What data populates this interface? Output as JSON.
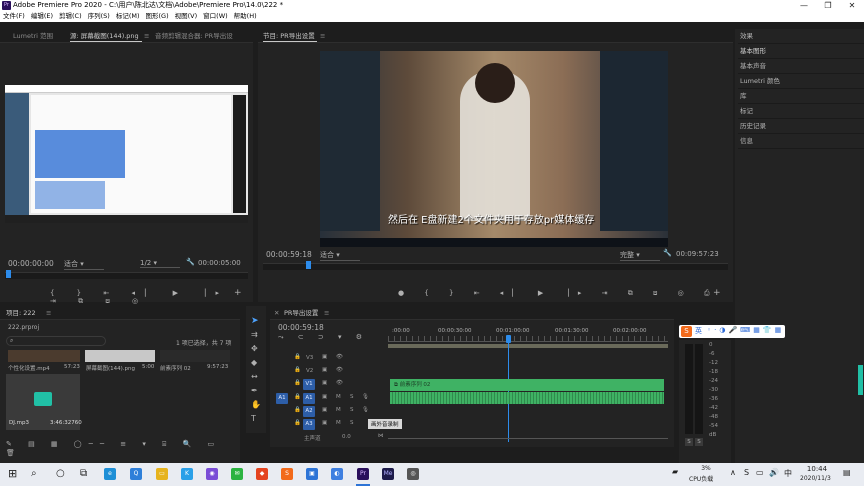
{
  "window": {
    "title": "Adobe Premiere Pro 2020 - C:\\用户\\陈北达\\文档\\Adobe\\Premiere Pro\\14.0\\222 *",
    "app_icon_text": "Pr"
  },
  "menu": [
    "文件(F)",
    "编辑(E)",
    "剪辑(C)",
    "序列(S)",
    "标记(M)",
    "图形(G)",
    "视图(V)",
    "窗口(W)",
    "帮助(H)"
  ],
  "source_panel": {
    "tabs": [
      "Lumetri 范围",
      "源: 屏幕截图(144).png",
      "音频剪辑混合器: PR导出设",
      "≡"
    ],
    "timecode_left": "00:00:00:00",
    "fit": "适合",
    "zoom": "1/2",
    "timecode_right": "00:00:05:00"
  },
  "program_panel": {
    "tab": "节目: PR导出设置",
    "timecode_left": "00:00:59:18",
    "fit": "适合",
    "quality": "完整",
    "timecode_right": "00:09:57:23",
    "subtitle": "然后在 E盘新建2个文件夹用于存放pr媒体缓存"
  },
  "right_panel": {
    "items": [
      "效果",
      "基本图形",
      "基本声音",
      "Lumetri 颜色",
      "库",
      "标记",
      "历史记录",
      "信息"
    ]
  },
  "project_panel": {
    "tab": "项目: 222",
    "file": "222.prproj",
    "selection": "1 项已选择，共 7 项",
    "items": [
      {
        "name": "个性化设置.mp4",
        "duration": "57:23"
      },
      {
        "name": "屏幕截图(144).png",
        "duration": "5:00"
      },
      {
        "name": "前素序列 02",
        "duration": "9:57:23"
      }
    ],
    "audio_item": {
      "name": "DJ.mp3",
      "duration": "3:46:32760"
    }
  },
  "timeline": {
    "tab": "PR导出设置",
    "timecode": "00:00:59:18",
    "ruler": [
      ":00:00",
      "00:00:30:00",
      "00:01:00:00",
      "00:01:30:00",
      "00:02:00:00"
    ],
    "tracks": [
      "V3",
      "V2",
      "V1",
      "A1",
      "A2",
      "A3"
    ],
    "master": "主声道",
    "master_value": "0.0",
    "clip_label": "前素序列 02",
    "tooltip": "画外音录制",
    "a1_label": "A1"
  },
  "meter": {
    "labels": [
      "0",
      "-6",
      "-12",
      "-18",
      "-24",
      "-30",
      "-36",
      "-42",
      "-48",
      "-54",
      "dB"
    ],
    "bottom": [
      "S",
      "S"
    ]
  },
  "sogou": {
    "label": "英"
  },
  "taskbar": {
    "cpu_percent": "3%",
    "cpu_label": "CPU负载",
    "lang": "中",
    "time": "10:44",
    "date": "2020/11/3",
    "apps": [
      "Pr",
      "Me"
    ]
  },
  "colors": {
    "accent_blue": "#2d8ceb",
    "clip_green": "#3fb264",
    "taskbar_bg": "#e9ecf2",
    "panel_bg": "#232323"
  }
}
